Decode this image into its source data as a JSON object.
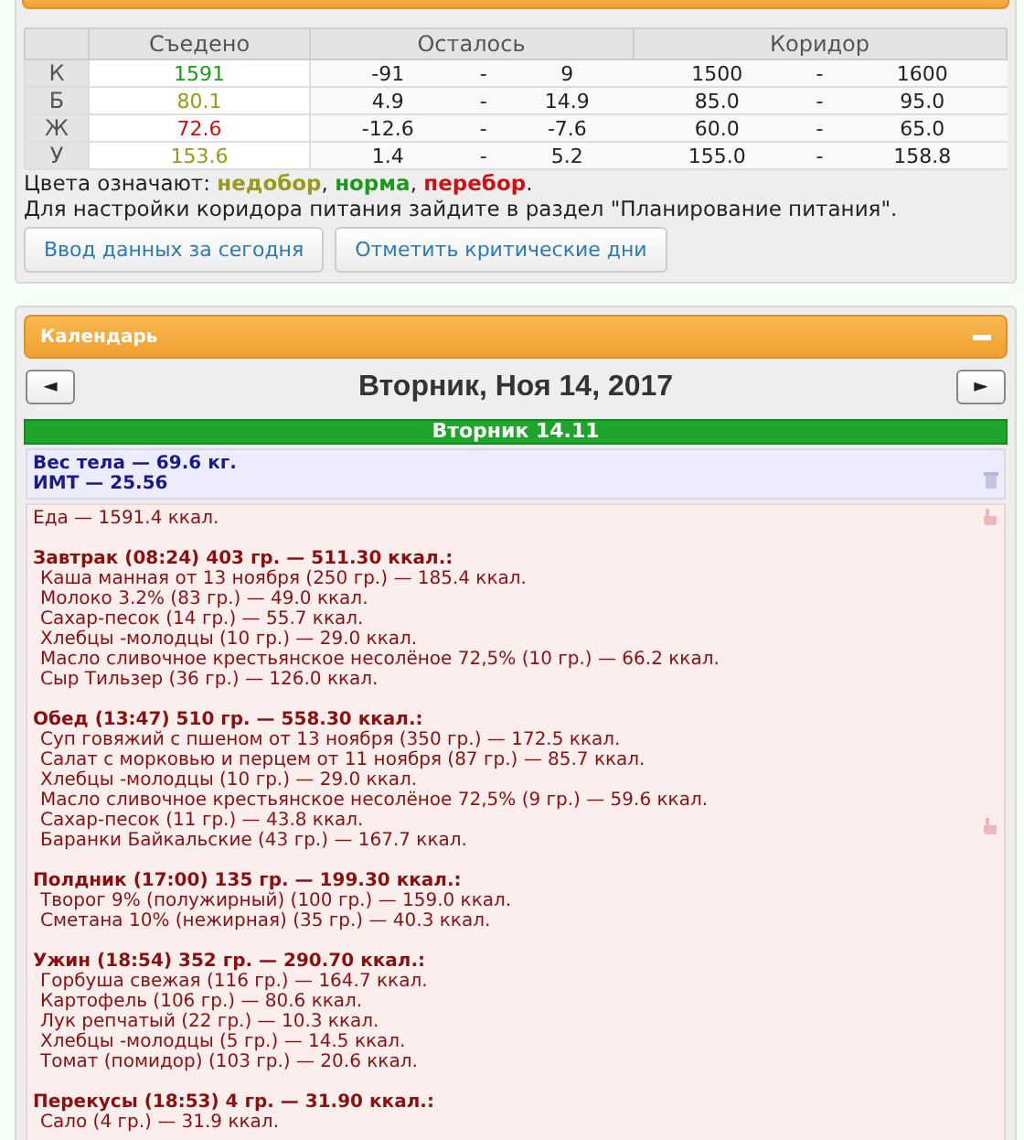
{
  "corridor_panel": {
    "table": {
      "columns": [
        "Съедено",
        "Осталось",
        "Коридор"
      ],
      "rows": [
        {
          "label": "К",
          "eaten": "1591",
          "color": "#1a9a1a",
          "left_from": "-91",
          "left_to": "9",
          "corridor_from": "1500",
          "corridor_to": "1600"
        },
        {
          "label": "Б",
          "eaten": "80.1",
          "color": "#9a9a1a",
          "left_from": "4.9",
          "left_to": "14.9",
          "corridor_from": "85.0",
          "corridor_to": "95.0"
        },
        {
          "label": "Ж",
          "eaten": "72.6",
          "color": "#d01010",
          "left_from": "-12.6",
          "left_to": "-7.6",
          "corridor_from": "60.0",
          "corridor_to": "65.0"
        },
        {
          "label": "У",
          "eaten": "153.6",
          "color": "#9a9a1a",
          "left_from": "1.4",
          "left_to": "5.2",
          "corridor_from": "155.0",
          "corridor_to": "158.8"
        }
      ],
      "range_separator": "-"
    },
    "legend": {
      "label": "Цвета означают:",
      "items": [
        {
          "text": "недобор",
          "color": "#9a9a1a",
          "punct": ","
        },
        {
          "text": "норма",
          "color": "#1a9a1a",
          "punct": ","
        },
        {
          "text": "перебор",
          "color": "#d01010",
          "punct": "."
        }
      ]
    },
    "note": "Для настройки коридора питания зайдите в раздел \"Планирование питания\".",
    "buttons": [
      "Ввод данных за сегодня",
      "Отметить критические дни"
    ]
  },
  "calendar_panel": {
    "title": "Календарь",
    "date_title": "Вторник, Ноя 14, 2017",
    "prev": "◄",
    "next": "►",
    "day_bar": "Вторник 14.11",
    "body_stats": [
      "Вес тела — 69.6 кг.",
      "ИМТ — 25.56"
    ],
    "food_total": "Еда — 1591.4 ккал.",
    "meals": [
      {
        "header": "Завтрак (08:24) 403 гр. — 511.30 ккал.:",
        "items": [
          "Каша манная от 13 ноября (250 гр.) — 185.4 ккал.",
          "Молоко 3.2% (83 гр.) — 49.0 ккал.",
          "Сахар-песок (14 гр.) — 55.7 ккал.",
          "Хлебцы -молодцы (10 гр.) — 29.0 ккал.",
          "Масло сливочное крестьянское несолёное 72,5% (10 гр.) — 66.2 ккал.",
          "Сыр Тильзер (36 гр.) — 126.0 ккал."
        ]
      },
      {
        "header": "Обед (13:47) 510 гр. — 558.30 ккал.:",
        "items": [
          "Суп говяжий с пшеном от 13 ноября (350 гр.) — 172.5 ккал.",
          "Салат с морковью и перцем от 11 ноября (87 гр.) — 85.7 ккал.",
          "Хлебцы -молодцы (10 гр.) — 29.0 ккал.",
          "Масло сливочное крестьянское несолёное 72,5% (9 гр.) — 59.6 ккал.",
          "Сахар-песок (11 гр.) — 43.8 ккал.",
          "Баранки Байкальские (43 гр.) — 167.7 ккал."
        ]
      },
      {
        "header": "Полдник (17:00) 135 гр. — 199.30 ккал.:",
        "items": [
          "Творог 9% (полужирный) (100 гр.) — 159.0 ккал.",
          "Сметана 10% (нежирная) (35 гр.) — 40.3 ккал."
        ]
      },
      {
        "header": "Ужин (18:54) 352 гр. — 290.70 ккал.:",
        "items": [
          "Горбуша свежая (116 гр.) — 164.7 ккал.",
          "Картофель (106 гр.) — 80.6 ккал.",
          "Лук репчатый (22 гр.) — 10.3 ккал.",
          "Хлебцы -молодцы (5 гр.) — 14.5 ккал.",
          "Томат (помидор) (103 гр.) — 20.6 ккал."
        ]
      },
      {
        "header": "Перекусы (18:53) 4 гр. — 31.90 ккал.:",
        "items": [
          "Сало (4 гр.) — 31.9 ккал."
        ]
      }
    ]
  }
}
